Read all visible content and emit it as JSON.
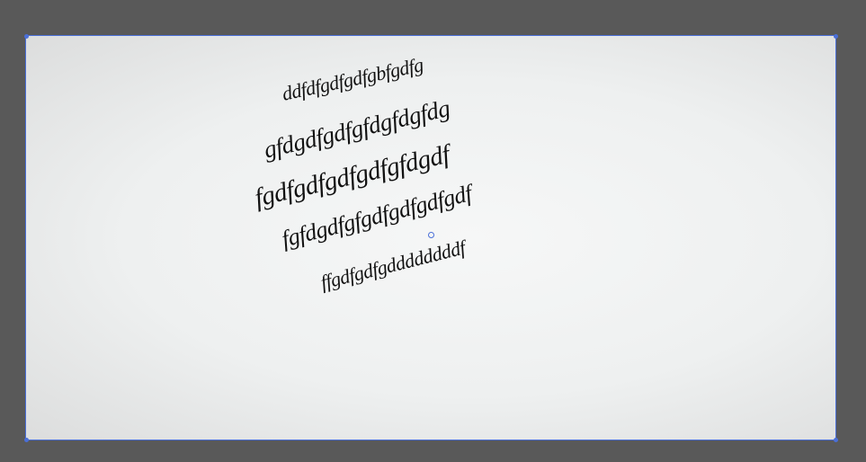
{
  "colors": {
    "pasteboard": "#595959",
    "artboard_border": "#4a6fd8",
    "text": "#111111"
  },
  "warped_text": {
    "lines": [
      "ddfdfgdfgdfgbfgdfg",
      "gfdgdfgdfgfdgfdgfdg",
      "fgdfgdfgdfgdfgfdgdf",
      "fgfdgdfgfgdfgdfgdfgdf",
      "ffgdfgdfgddddddddf"
    ]
  }
}
